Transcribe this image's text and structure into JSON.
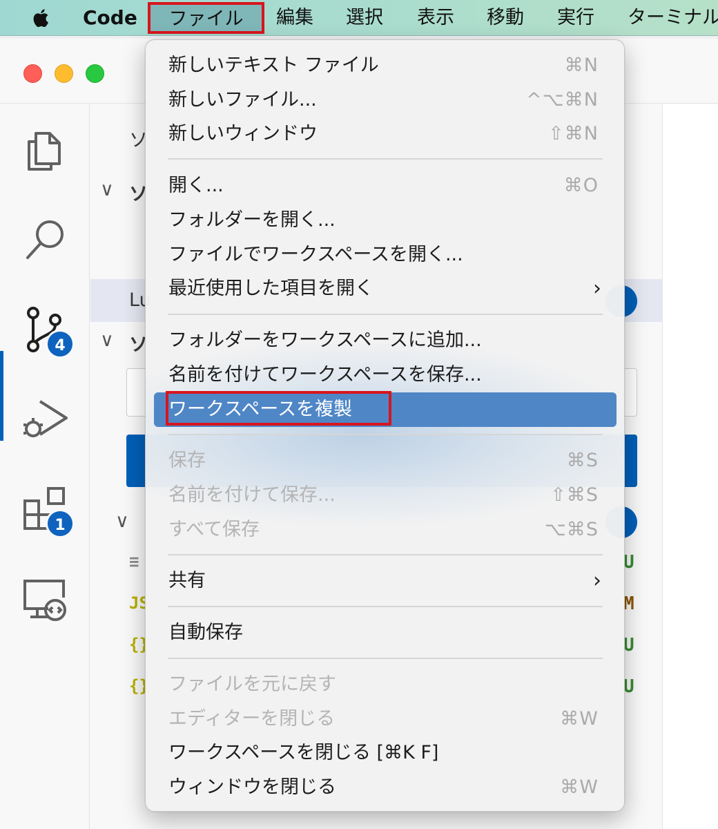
{
  "menubar": {
    "app_name": "Code",
    "items": [
      "ファイル",
      "編集",
      "選択",
      "表示",
      "移動",
      "実行",
      "ターミナル"
    ]
  },
  "activitybar": {
    "icons": [
      "explorer-icon",
      "search-icon",
      "source-control-icon",
      "run-debug-icon",
      "extensions-icon",
      "remote-explorer-icon"
    ],
    "source_control_badge": "4",
    "extensions_badge": "1"
  },
  "sidebar": {
    "title_fragment": "ソ",
    "section1_fragment": "ソ",
    "repo_row_fragment": "Lu",
    "section2_fragment": "ソ",
    "file_rows": [
      {
        "icon": "≡",
        "status": "U",
        "status_color": "#388a34"
      },
      {
        "icon": "JS",
        "status": "M",
        "status_color": "#895503"
      },
      {
        "icon": "{}",
        "status": "U",
        "status_color": "#388a34"
      },
      {
        "icon": "{}",
        "status": "U",
        "status_color": "#388a34"
      }
    ]
  },
  "file_menu": {
    "new_text_file": {
      "label": "新しいテキスト ファイル",
      "shortcut": "⌘N"
    },
    "new_file": {
      "label": "新しいファイル...",
      "shortcut": "^⌥⌘N"
    },
    "new_window": {
      "label": "新しいウィンドウ",
      "shortcut": "⇧⌘N"
    },
    "open": {
      "label": "開く...",
      "shortcut": "⌘O"
    },
    "open_folder": {
      "label": "フォルダーを開く..."
    },
    "open_workspace_from_file": {
      "label": "ファイルでワークスペースを開く..."
    },
    "open_recent": {
      "label": "最近使用した項目を開く",
      "arrow": "›"
    },
    "add_folder_to_workspace": {
      "label": "フォルダーをワークスペースに追加..."
    },
    "save_workspace_as": {
      "label": "名前を付けてワークスペースを保存..."
    },
    "duplicate_workspace": {
      "label": "ワークスペースを複製"
    },
    "save": {
      "label": "保存",
      "shortcut": "⌘S"
    },
    "save_as": {
      "label": "名前を付けて保存...",
      "shortcut": "⇧⌘S"
    },
    "save_all": {
      "label": "すべて保存",
      "shortcut": "⌥⌘S"
    },
    "share": {
      "label": "共有",
      "arrow": "›"
    },
    "auto_save": {
      "label": "自動保存"
    },
    "revert_file": {
      "label": "ファイルを元に戻す"
    },
    "close_editor": {
      "label": "エディターを閉じる",
      "shortcut": "⌘W"
    },
    "close_workspace": {
      "label": "ワークスペースを閉じる [⌘K F]"
    },
    "close_window": {
      "label": "ウィンドウを閉じる",
      "shortcut": "⌘W"
    }
  },
  "colors": {
    "menubar_bg": "#a8dccf",
    "highlight": "#4f86c6",
    "annotation_red": "#d8151e",
    "accent_blue": "#005fb8"
  }
}
